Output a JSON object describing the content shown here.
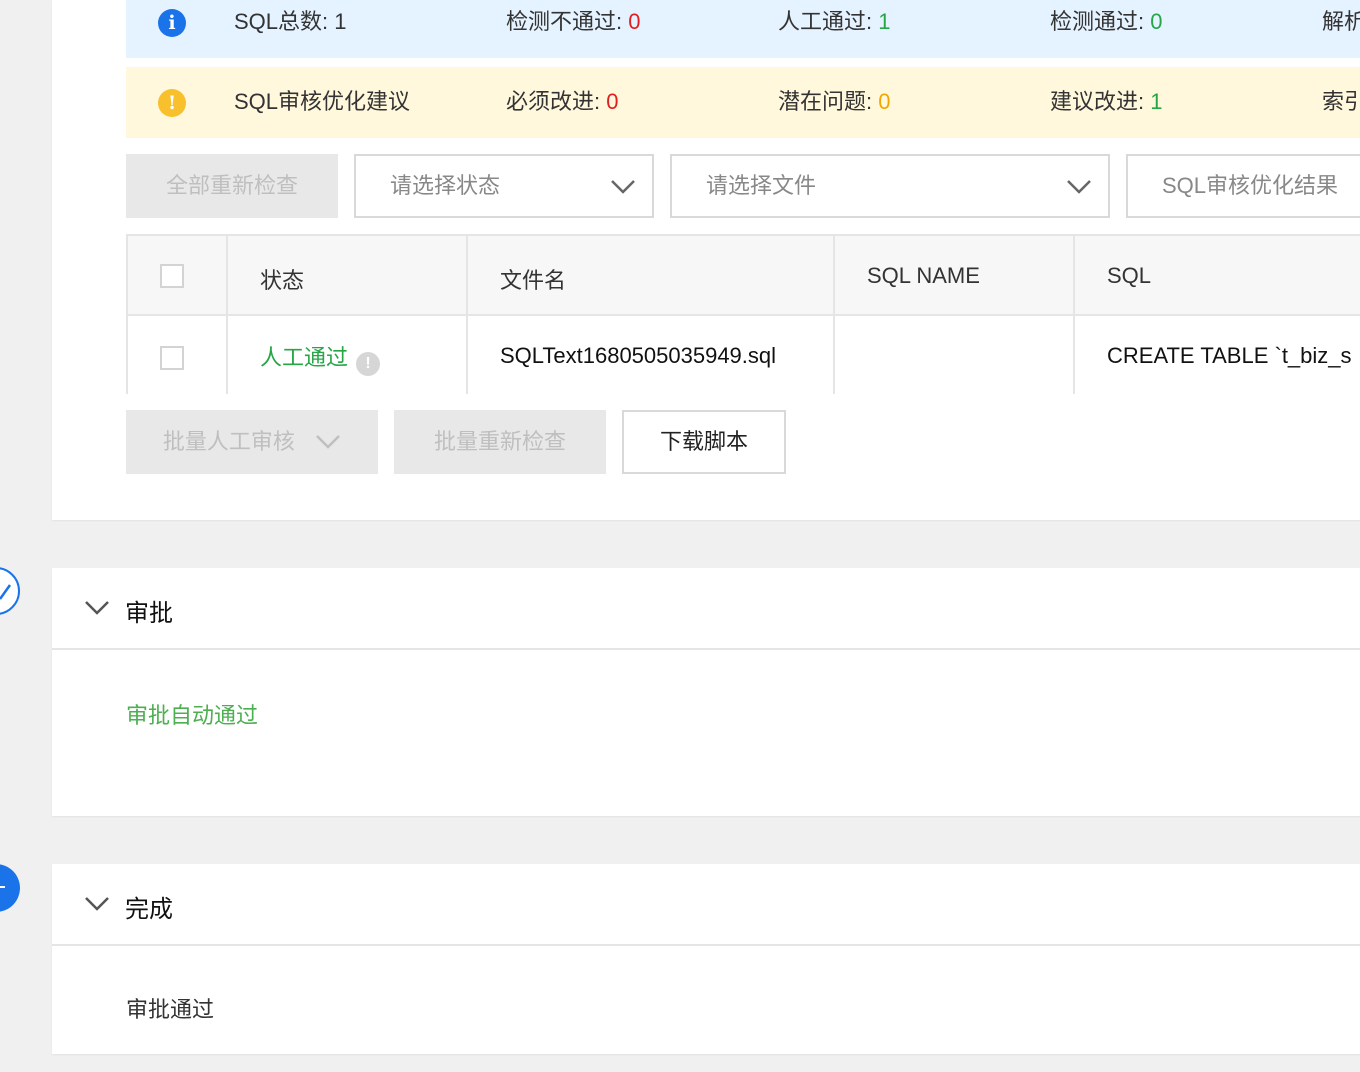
{
  "summary": {
    "total_label": "SQL总数: ",
    "total_value": "1",
    "fail_label": "检测不通过: ",
    "fail_value": "0",
    "manual_label": "人工通过: ",
    "manual_value": "1",
    "pass_label": "检测通过: ",
    "pass_value": "0",
    "parse_label": "解析"
  },
  "advice": {
    "title": "SQL审核优化建议",
    "must_label": "必须改进: ",
    "must_value": "0",
    "potential_label": "潜在问题: ",
    "potential_value": "0",
    "suggest_label": "建议改进: ",
    "suggest_value": "1",
    "index_label": "索引"
  },
  "toolbar": {
    "recheck_all": "全部重新检查",
    "status_placeholder": "请选择状态",
    "file_placeholder": "请选择文件",
    "result_placeholder": "SQL审核优化结果"
  },
  "table": {
    "headers": {
      "status": "状态",
      "filename": "文件名",
      "sql_name": "SQL NAME",
      "sql": "SQL"
    },
    "rows": [
      {
        "status": "人工通过",
        "filename": "SQLText1680505035949.sql",
        "sql_name": "",
        "sql": "CREATE TABLE `t_biz_s"
      }
    ]
  },
  "actions": {
    "batch_manual": "批量人工审核",
    "batch_recheck": "批量重新检查",
    "download": "下载脚本"
  },
  "approval": {
    "title": "审批",
    "status": "审批自动通过"
  },
  "complete": {
    "title": "完成",
    "status": "审批通过"
  },
  "colors": {
    "primary": "#1a73e8",
    "success": "#26a645",
    "danger": "#e02020",
    "warning": "#f0a800"
  }
}
